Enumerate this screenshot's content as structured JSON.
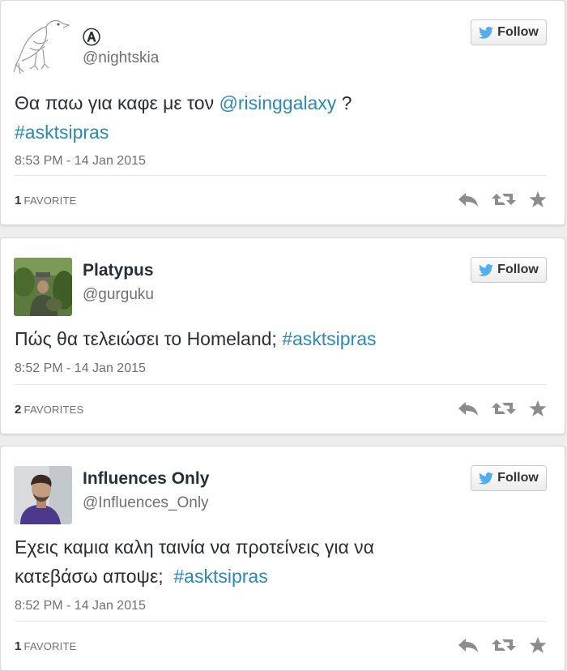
{
  "tweets": [
    {
      "name": "Ⓐ",
      "handle": "@nightskia",
      "follow_label": "Follow",
      "text": {
        "part1": "Θα παω για καφε με τον ",
        "mention": "@risinggalaxy",
        "part2": " ?",
        "hashtag": "#asktsipras"
      },
      "time": "8:53 PM - 14 Jan 2015",
      "fav_count": "1",
      "fav_label": "FAVORITE"
    },
    {
      "name": "Platypus",
      "handle": "@gurguku",
      "follow_label": "Follow",
      "text": {
        "part1": "Πώς θα τελειώσει το Homeland; ",
        "hashtag": "#asktsipras"
      },
      "time": "8:52 PM - 14 Jan 2015",
      "fav_count": "2",
      "fav_label": "FAVORITES"
    },
    {
      "name": "Influences Only",
      "handle": "@Influences_Only",
      "follow_label": "Follow",
      "text": {
        "part1": "Εχεις καμια καλη ταινία να προτείνεις για να κατεβάσω αποψε;  ",
        "hashtag": "#asktsipras"
      },
      "time": "8:52 PM - 14 Jan 2015",
      "fav_count": "1",
      "fav_label": "FAVORITE"
    }
  ],
  "icons": {
    "follow": "twitter-bird-icon",
    "reply": "reply-icon",
    "retweet": "retweet-icon",
    "favorite": "star-icon"
  },
  "colors": {
    "link": "#2a89b6",
    "twitter_blue": "#55acee",
    "action_icon": "#8c8c8c"
  }
}
